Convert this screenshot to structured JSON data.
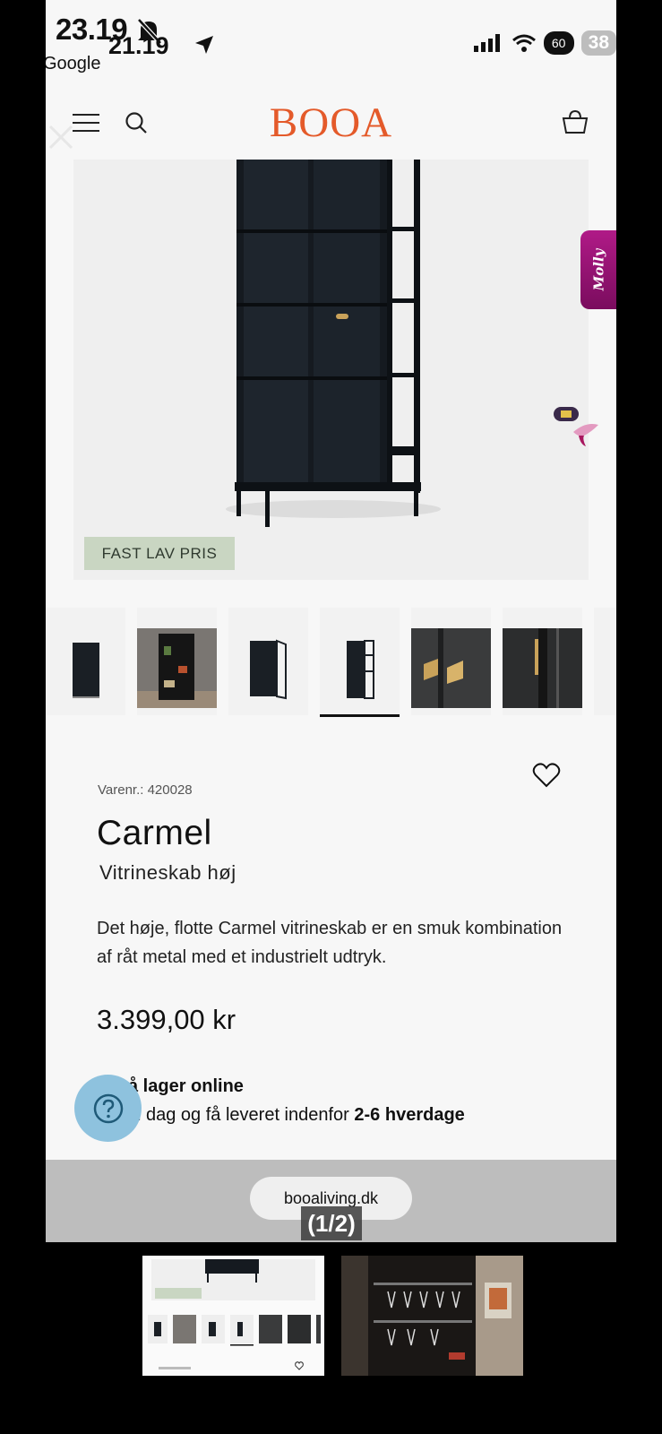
{
  "status_bar": {
    "time_back": "23.19",
    "time_front": "21.19",
    "back_app": "Google",
    "battery": "38",
    "eye": "60"
  },
  "header": {
    "logo": "BOOA"
  },
  "product_image": {
    "badge": "FAST LAV PRIS"
  },
  "molly_tab": {
    "label": "Molly"
  },
  "thumbnails": {
    "count": 7,
    "selected_index": 3
  },
  "product": {
    "sku": "Varenr.: 420028",
    "title": "Carmel",
    "subtitle": "Vitrineskab høj",
    "description": "Det høje, flotte Carmel vitrineskab er en smuk kombination af råt metal med et industrielt udtryk.",
    "price": "3.399,00 kr",
    "stock_title": "å lager online",
    "stock_text": "l i dag og få leveret indenfor ",
    "stock_bold": "2-6 hverdage"
  },
  "browser": {
    "url": "booaliving.dk",
    "counter": "(1/2)"
  },
  "colors": {
    "logo": "#e45a2a",
    "badge_bg": "#c9d6c2",
    "molly": "#9b1277",
    "help": "#8ec2de"
  }
}
